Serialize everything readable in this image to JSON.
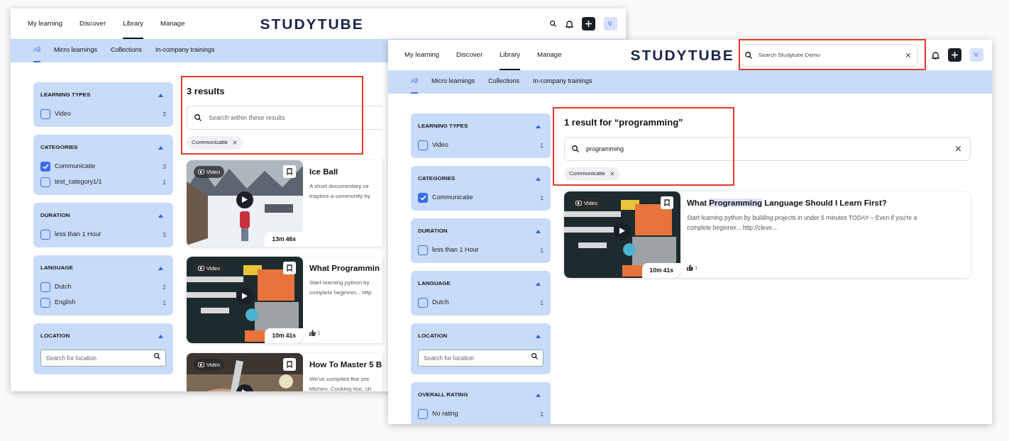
{
  "windows": [
    {
      "nav": [
        {
          "label": "My learning",
          "selected": false
        },
        {
          "label": "Discover",
          "selected": false
        },
        {
          "label": "Library",
          "selected": true
        },
        {
          "label": "Manage",
          "selected": false
        }
      ],
      "logo": "STUDYTUBE",
      "header_search": {
        "kind": "icon"
      },
      "avatar": "V.",
      "subnav": [
        {
          "label": "All",
          "selected": true
        },
        {
          "label": "Micro learnings",
          "selected": false
        },
        {
          "label": "Collections",
          "selected": false
        },
        {
          "label": "In-company trainings",
          "selected": false
        }
      ],
      "filters": [
        {
          "kind": "checklist",
          "title": "LEARNING TYPES",
          "expanded": true,
          "options": [
            {
              "label": "Video",
              "count": "3",
              "checked": false
            }
          ]
        },
        {
          "kind": "checklist",
          "title": "CATEGORIES",
          "expanded": true,
          "options": [
            {
              "label": "Communicatie",
              "count": "3",
              "checked": true
            },
            {
              "label": "test_category1/1",
              "count": "1",
              "checked": false
            }
          ]
        },
        {
          "kind": "checklist",
          "title": "DURATION",
          "expanded": true,
          "options": [
            {
              "label": "less than 1 Hour",
              "count": "3",
              "checked": false
            }
          ]
        },
        {
          "kind": "checklist",
          "title": "LANGUAGE",
          "expanded": true,
          "options": [
            {
              "label": "Dutch",
              "count": "2",
              "checked": false
            },
            {
              "label": "English",
              "count": "1",
              "checked": false
            }
          ]
        },
        {
          "kind": "search",
          "title": "LOCATION",
          "expanded": true,
          "placeholder": "Search for location"
        }
      ],
      "results_heading": "3 results",
      "results_search": {
        "placeholder": "Search within these results"
      },
      "chips": [
        "Communicatie"
      ],
      "cards": [
        {
          "badge": "Video",
          "title_parts": [
            {
              "text": "Ice Ball",
              "highlighted": false
            }
          ],
          "description_lines": [
            "A short documentary ce",
            "inspires a community by"
          ],
          "duration": "13m 46s"
        },
        {
          "badge": "Video",
          "title_parts": [
            {
              "text": "What Programmin",
              "highlighted": false
            }
          ],
          "description_lines": [
            "Start learning python by",
            "complete beginner... http"
          ],
          "duration": "10m 41s",
          "likes": "1"
        },
        {
          "badge": "Video",
          "title_parts": [
            {
              "text": "How To Master 5 B",
              "highlighted": false
            }
          ],
          "description_lines": [
            "We've compiled five pre",
            "kitchen. Cooking rice, ch"
          ]
        }
      ]
    },
    {
      "nav": [
        {
          "label": "My learning",
          "selected": false
        },
        {
          "label": "Discover",
          "selected": false
        },
        {
          "label": "Library",
          "selected": true
        },
        {
          "label": "Manage",
          "selected": false
        }
      ],
      "logo": "STUDYTUBE",
      "header_search": {
        "kind": "field",
        "placeholder": "Search Studytube Demo"
      },
      "avatar": "V.",
      "subnav": [
        {
          "label": "All",
          "selected": true
        },
        {
          "label": "Micro learnings",
          "selected": false
        },
        {
          "label": "Collections",
          "selected": false
        },
        {
          "label": "In-company trainings",
          "selected": false
        }
      ],
      "filters": [
        {
          "kind": "checklist",
          "title": "LEARNING TYPES",
          "expanded": true,
          "options": [
            {
              "label": "Video",
              "count": "1",
              "checked": false
            }
          ]
        },
        {
          "kind": "checklist",
          "title": "CATEGORIES",
          "expanded": true,
          "options": [
            {
              "label": "Communicatie",
              "count": "1",
              "checked": true
            }
          ]
        },
        {
          "kind": "checklist",
          "title": "DURATION",
          "expanded": true,
          "options": [
            {
              "label": "less than 1 Hour",
              "count": "1",
              "checked": false
            }
          ]
        },
        {
          "kind": "checklist",
          "title": "LANGUAGE",
          "expanded": true,
          "options": [
            {
              "label": "Dutch",
              "count": "1",
              "checked": false
            }
          ]
        },
        {
          "kind": "search",
          "title": "LOCATION",
          "expanded": true,
          "placeholder": "Search for location"
        },
        {
          "kind": "checklist",
          "title": "OVERALL RATING",
          "expanded": true,
          "options": [
            {
              "label": "No rating",
              "count": "1",
              "checked": false
            }
          ]
        }
      ],
      "results_heading": "1 result for “programming”",
      "results_search": {
        "value": "programming"
      },
      "chips": [
        "Communicatie"
      ],
      "cards": [
        {
          "badge": "Video",
          "title_parts": [
            {
              "text": "What ",
              "highlighted": false
            },
            {
              "text": "Programming",
              "highlighted": true
            },
            {
              "text": " Language Should I Learn First?",
              "highlighted": false
            }
          ],
          "description_lines": [
            "Start learning python by building projects in under 5 minutes TODAY – Even if you're a",
            "complete beginner... http://cleve..."
          ],
          "duration": "10m 41s",
          "likes": "1"
        }
      ]
    }
  ]
}
